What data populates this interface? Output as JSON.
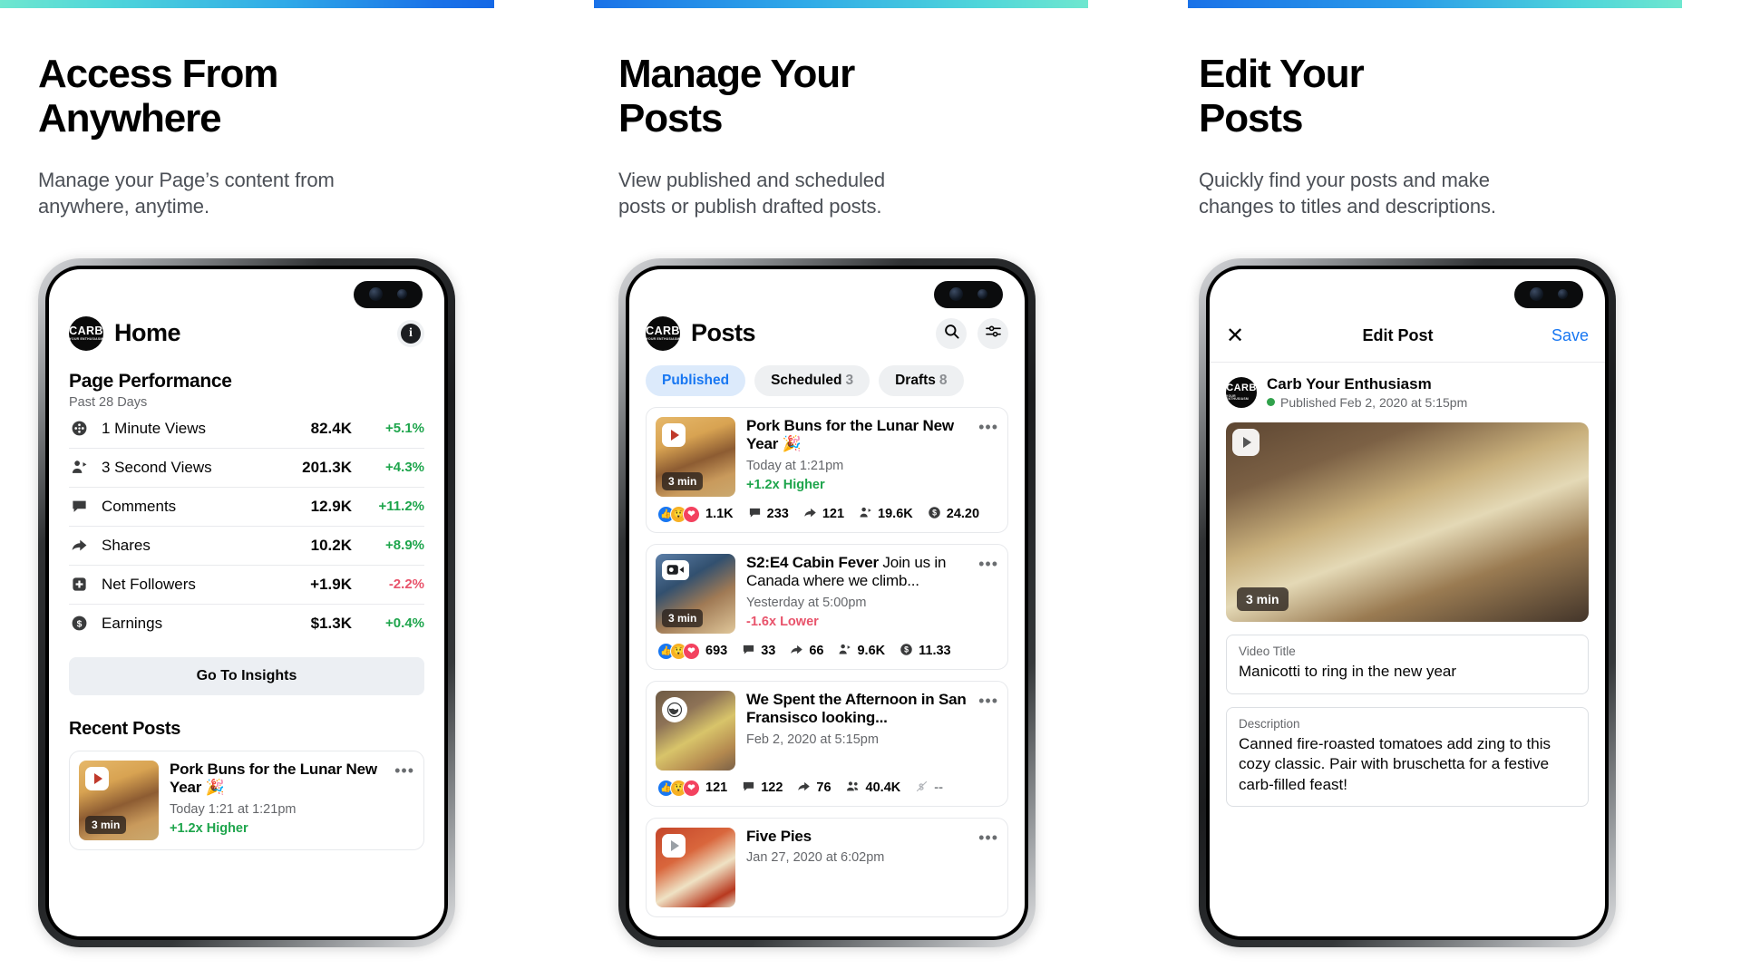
{
  "accent": {
    "blue": "#1877f2",
    "green": "#1ea54c",
    "red": "#e8536b",
    "gradient_start": "#6fe7cf",
    "gradient_end": "#1468e6"
  },
  "columns": [
    {
      "headline": "Access From\nAnywhere",
      "subhead": "Manage your Page’s content from\nanywhere, anytime."
    },
    {
      "headline": "Manage Your\nPosts",
      "subhead": "View published and scheduled\nposts or publish drafted posts."
    },
    {
      "headline": "Edit Your\nPosts",
      "subhead": "Quickly find your posts and make\nchanges to titles and descriptions."
    }
  ],
  "brand": {
    "line1": "CARB",
    "line2": "YOUR ENTHUSIASM"
  },
  "phone1": {
    "title": "Home",
    "info_glyph": "i",
    "performance": {
      "title": "Page Performance",
      "subtitle": "Past 28 Days",
      "metrics": [
        {
          "icon": "film-reel-icon",
          "label": "1 Minute Views",
          "value": "82.4K",
          "delta": "+5.1%",
          "dir": "up"
        },
        {
          "icon": "person-play-icon",
          "label": "3 Second Views",
          "value": "201.3K",
          "delta": "+4.3%",
          "dir": "up"
        },
        {
          "icon": "comment-icon",
          "label": "Comments",
          "value": "12.9K",
          "delta": "+11.2%",
          "dir": "up"
        },
        {
          "icon": "share-arrow-icon",
          "label": "Shares",
          "value": "10.2K",
          "delta": "+8.9%",
          "dir": "up"
        },
        {
          "icon": "add-follower-icon",
          "label": "Net Followers",
          "value": "+1.9K",
          "delta": "-2.2%",
          "dir": "down"
        },
        {
          "icon": "dollar-icon",
          "label": "Earnings",
          "value": "$1.3K",
          "delta": "+0.4%",
          "dir": "up"
        }
      ]
    },
    "insights_button": "Go To Insights",
    "recent_posts_title": "Recent Posts",
    "recent_post": {
      "title": "Pork Buns for the Lunar New Year 🎉",
      "time": "Today 1:21 at 1:21pm",
      "perf": "+1.2x Higher",
      "duration": "3 min",
      "menu": "•••"
    }
  },
  "phone2": {
    "title": "Posts",
    "search_icon": "search-icon",
    "filter_icon": "sliders-icon",
    "tabs": [
      {
        "label": "Published",
        "count": "",
        "active": true
      },
      {
        "label": "Scheduled",
        "count": "3",
        "active": false
      },
      {
        "label": "Drafts",
        "count": "8",
        "active": false
      }
    ],
    "posts": [
      {
        "thumb": "t-buns",
        "chip": "play",
        "duration": "3 min",
        "title_bold": "Pork Buns for the Lunar New Year 🎉",
        "title_light": "",
        "time": "Today at 1:21pm",
        "perf": "+1.2x Higher",
        "perf_dir": "up",
        "reactions": "1.1K",
        "comments": "233",
        "shares": "121",
        "views": "19.6K",
        "earnings": "24.20"
      },
      {
        "thumb": "t-cabin",
        "chip": "cam",
        "duration": "3 min",
        "title_bold": "S2:E4 Cabin Fever",
        "title_light": " Join us in Canada where we climb...",
        "time": "Yesterday at 5:00pm",
        "perf": "-1.6x Lower",
        "perf_dir": "down",
        "reactions": "693",
        "comments": "33",
        "shares": "66",
        "views": "9.6K",
        "earnings": "11.33"
      },
      {
        "thumb": "t-sf",
        "chip": "globe",
        "duration": "",
        "title_bold": "We Spent the Afternoon in San Fransisco looking...",
        "title_light": "",
        "time": "Feb 2, 2020 at 5:15pm",
        "perf": "",
        "perf_dir": "",
        "reactions": "121",
        "comments": "122",
        "shares": "76",
        "views": "40.4K",
        "earnings": "--"
      },
      {
        "thumb": "t-pies",
        "chip": "play",
        "duration": "",
        "title_bold": "Five Pies",
        "title_light": "",
        "time": "Jan 27, 2020 at 6:02pm",
        "perf": "",
        "perf_dir": "",
        "reactions": "",
        "comments": "",
        "shares": "",
        "views": "",
        "earnings": ""
      }
    ]
  },
  "phone3": {
    "close_icon": "close-icon",
    "title": "Edit Post",
    "save": "Save",
    "author": "Carb Your Enthusiasm",
    "status": "Published Feb 2, 2020 at 5:15pm",
    "video_duration": "3 min",
    "fields": [
      {
        "label": "Video Title",
        "value": "Manicotti to ring in the new year"
      },
      {
        "label": "Description",
        "value": "Canned fire-roasted tomatoes add zing to this cozy classic. Pair with bruschetta for a festive carb-filled feast!"
      }
    ]
  }
}
